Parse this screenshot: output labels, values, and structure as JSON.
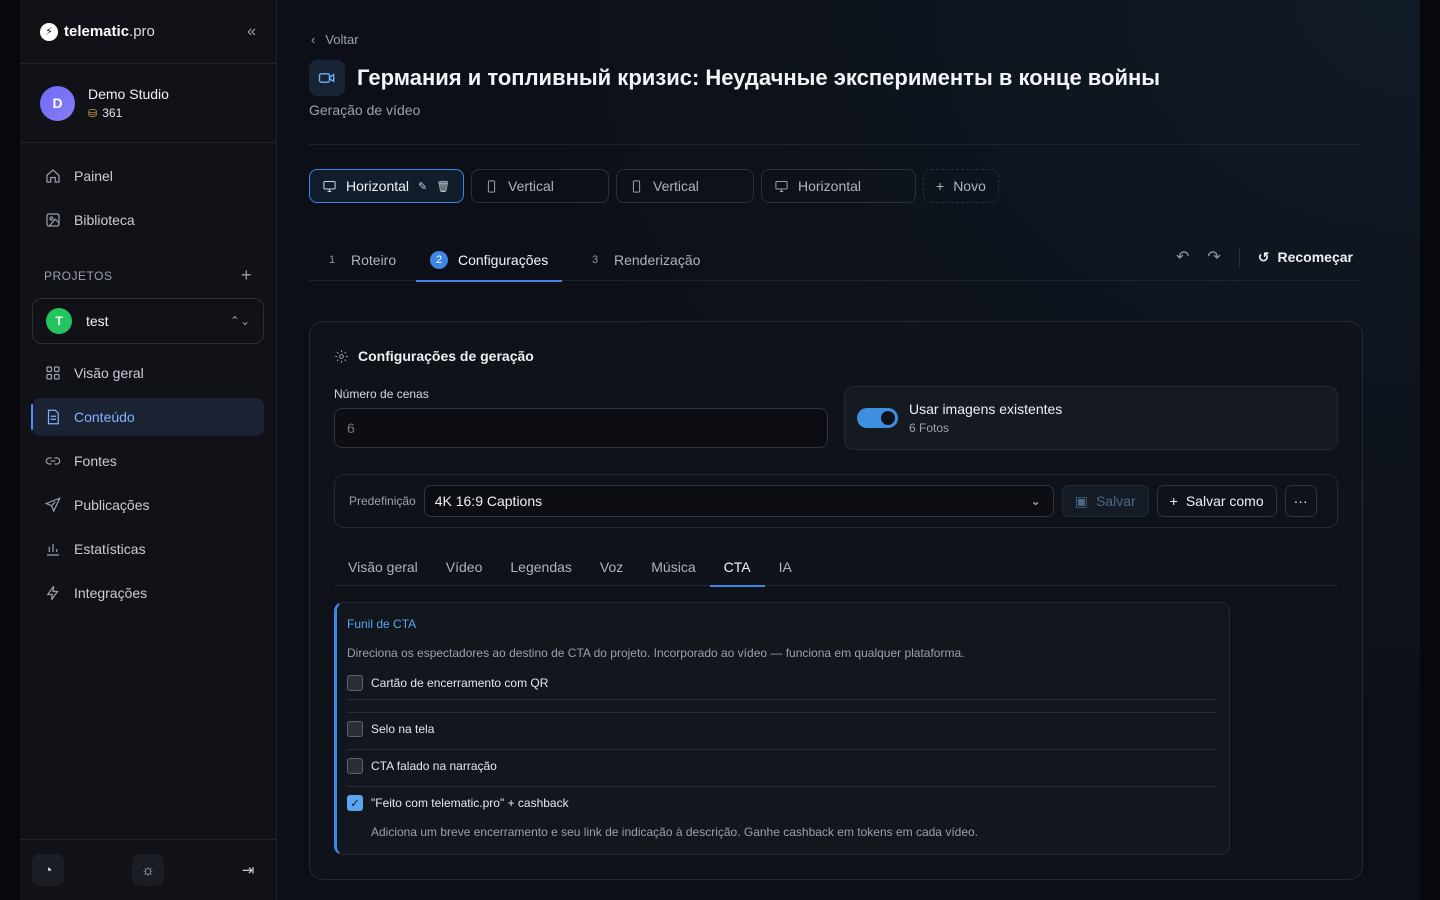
{
  "brand": {
    "name": "telematic",
    "suffix": ".pro"
  },
  "account": {
    "initial": "D",
    "name": "Demo Studio",
    "tokens": "361"
  },
  "nav_main": [
    {
      "label": "Painel",
      "icon": "home-icon"
    },
    {
      "label": "Biblioteca",
      "icon": "image-icon"
    }
  ],
  "projects": {
    "heading": "PROJETOS",
    "selected_initial": "T",
    "selected_name": "test"
  },
  "nav_project": [
    {
      "label": "Visão geral",
      "icon": "grid-icon"
    },
    {
      "label": "Conteúdo",
      "icon": "document-icon",
      "active": true
    },
    {
      "label": "Fontes",
      "icon": "link-icon"
    },
    {
      "label": "Publicações",
      "icon": "send-icon"
    },
    {
      "label": "Estatísticas",
      "icon": "bar-chart-icon"
    },
    {
      "label": "Integrações",
      "icon": "bolt-icon"
    }
  ],
  "header": {
    "back_label": "Voltar",
    "title": "Германия и топливный кризис: Неудачные эксперименты в конце войны",
    "subtitle": "Geração de vídeo"
  },
  "variants": [
    {
      "label": "Horizontal",
      "active": true
    },
    {
      "label": "Vertical"
    },
    {
      "label": "Vertical"
    },
    {
      "label": "Horizontal"
    },
    {
      "label": "Novo"
    }
  ],
  "steps": [
    {
      "num": "1",
      "label": "Roteiro"
    },
    {
      "num": "2",
      "label": "Configurações",
      "active": true
    },
    {
      "num": "3",
      "label": "Renderização"
    }
  ],
  "restart_label": "Recomeçar",
  "settings": {
    "title": "Configurações de geração",
    "scenes_label": "Número de cenas",
    "scenes_placeholder": "6",
    "use_images_title": "Usar imagens existentes",
    "use_images_sub": "6 Fotos",
    "use_images_on": true
  },
  "preset": {
    "label": "Predefinição",
    "value": "4K 16:9 Captions",
    "save_label": "Salvar",
    "save_as_label": "Salvar como"
  },
  "subtabs": [
    "Visão geral",
    "Vídeo",
    "Legendas",
    "Voz",
    "Música",
    "CTA",
    "IA"
  ],
  "active_subtab": "CTA",
  "cta": {
    "heading": "Funil de CTA",
    "description": "Direciona os espectadores ao destino de CTA do projeto. Incorporado ao vídeo — funciona em qualquer plataforma.",
    "options": [
      {
        "label": "Cartão de encerramento com QR",
        "checked": false
      },
      {
        "label": "Selo na tela",
        "checked": false
      },
      {
        "label": "CTA falado na narração",
        "checked": false
      },
      {
        "label": "\"Feito com telematic.pro\" + cashback",
        "checked": true
      }
    ],
    "note": "Adiciona um breve encerramento e seu link de indicação à descrição. Ganhe cashback em tokens em cada vídeo."
  },
  "colors": {
    "accent": "#3d86e8",
    "accent_light": "#5aa4f0",
    "project_dot": "#22c55e"
  }
}
